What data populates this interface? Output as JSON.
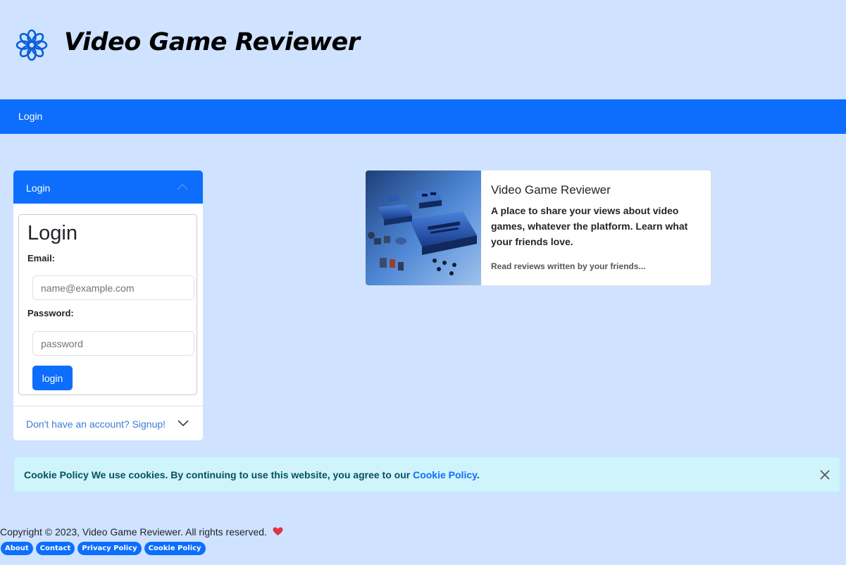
{
  "header": {
    "logo_icon": "flower-icon",
    "title": "Video Game Reviewer"
  },
  "navbar": {
    "links": [
      {
        "label": "Login"
      }
    ],
    "color": "#0d6efd"
  },
  "accordion": {
    "login_header": "Login",
    "login_form": {
      "heading": "Login",
      "email_label": "Email:",
      "email_placeholder": "name@example.com",
      "email_value": "",
      "password_label": "Password:",
      "password_placeholder": "password",
      "password_value": "",
      "submit_label": "login"
    },
    "signup_header": "Don't have an account? Signup!"
  },
  "info_card": {
    "title": "Video Game Reviewer",
    "text": "A place to share your views about video games, whatever the platform. Learn what your friends love.",
    "subtext": "Read reviews written by your friends..."
  },
  "cookie": {
    "bold_prefix": "Cookie Policy",
    "message": "We use cookies. By continuing to use this website, you agree to our",
    "link": "Cookie Policy",
    "suffix": ".",
    "close_icon": "close-icon"
  },
  "footer": {
    "copyright": "Copyright © 2023, Video Game Reviewer. All rights reserved.",
    "heart_icon": "heart-icon",
    "links": [
      "About",
      "Contact",
      "Privacy Policy",
      "Cookie Policy"
    ]
  }
}
